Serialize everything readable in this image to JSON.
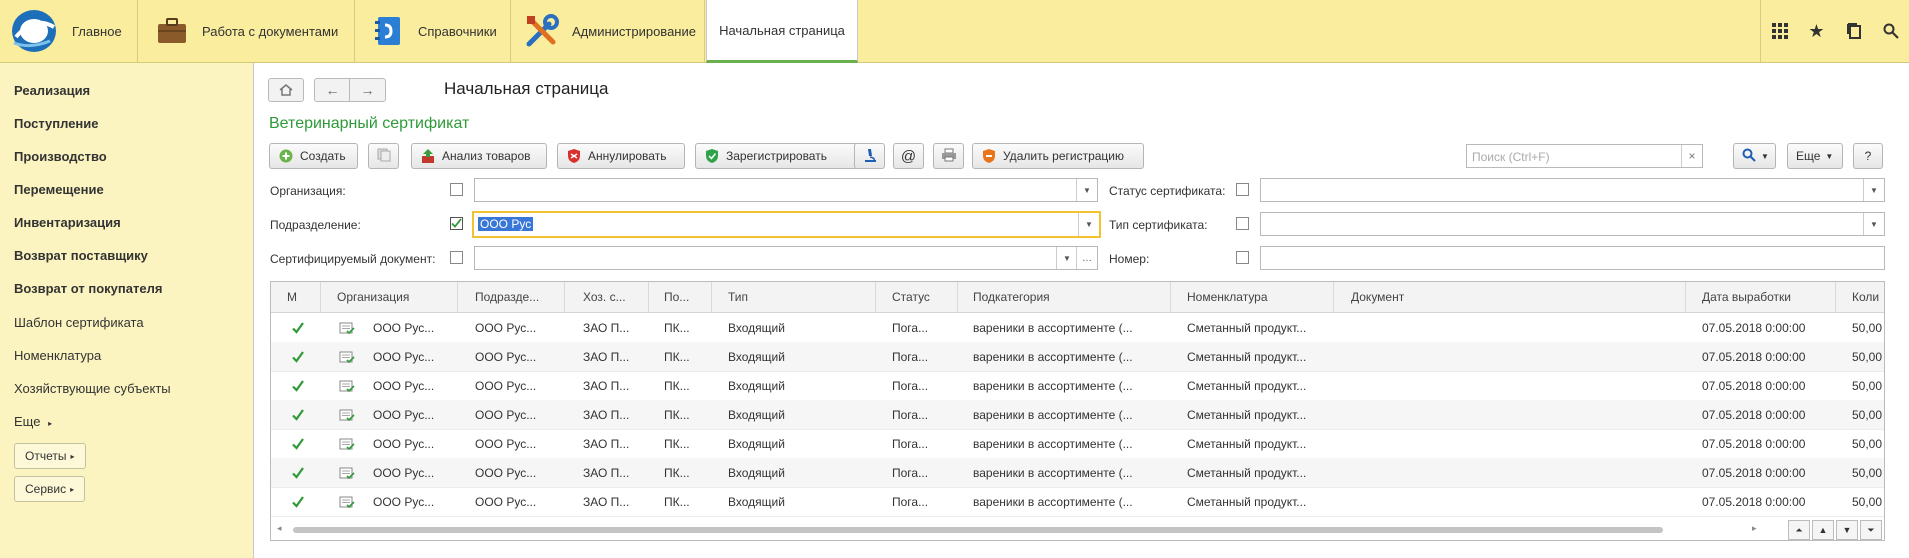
{
  "topbar": {
    "home_label": "Главное",
    "sections": [
      {
        "label": "Работа с документами",
        "icon": "briefcase-icon"
      },
      {
        "label": "Справочники",
        "icon": "phonebook-icon"
      },
      {
        "label": "Администрирование",
        "icon": "tools-icon"
      }
    ],
    "active_tab": "Начальная страница",
    "right_icons": [
      "grid-icon",
      "star-icon",
      "history-icon",
      "search-icon"
    ]
  },
  "sidebar": {
    "bold_items": [
      "Реализация",
      "Поступление",
      "Производство",
      "Перемещение",
      "Инвентаризация",
      "Возврат поставщику",
      "Возврат от покупателя"
    ],
    "items": [
      "Шаблон сертификата",
      "Номенклатура",
      "Хозяйствующие субъекты"
    ],
    "more_label": "Еще",
    "reports_label": "Отчеты",
    "service_label": "Сервис"
  },
  "page": {
    "title": "Начальная страница",
    "form_title": "Ветеринарный сертификат"
  },
  "toolbar": {
    "create": "Создать",
    "analyze": "Анализ товаров",
    "annul": "Аннулировать",
    "register": "Зарегистрировать",
    "at": "@",
    "delete_reg": "Удалить регистрацию",
    "search_placeholder": "Поиск (Ctrl+F)",
    "more": "Еще",
    "help": "?"
  },
  "filters": {
    "org_label": "Организация:",
    "dept_label": "Подразделение:",
    "dept_value": "ООО Рус",
    "doc_label": "Сертифицируемый документ:",
    "status_label": "Статус сертификата:",
    "type_label": "Тип сертификата:",
    "number_label": "Номер:"
  },
  "table": {
    "headers": [
      "М",
      "Организация",
      "Подразде...",
      "Хоз. с...",
      "По...",
      "Тип",
      "Статус",
      "Подкатегория",
      "Номенклатура",
      "Документ",
      "Дата выработки",
      "Коли"
    ],
    "rows": [
      {
        "org": "ООО Рус...",
        "dept": "ООО Рус...",
        "hoz": "ЗАО П...",
        "po": "ПК...",
        "type": "Входящий",
        "status": "Пога...",
        "subcat": "вареники в ассортименте (...",
        "nom": "Сметанный продукт...",
        "doc": "",
        "date": "07.05.2018 0:00:00",
        "qty": "50,00"
      },
      {
        "org": "ООО Рус...",
        "dept": "ООО Рус...",
        "hoz": "ЗАО П...",
        "po": "ПК...",
        "type": "Входящий",
        "status": "Пога...",
        "subcat": "вареники в ассортименте (...",
        "nom": "Сметанный продукт...",
        "doc": "",
        "date": "07.05.2018 0:00:00",
        "qty": "50,00"
      },
      {
        "org": "ООО Рус...",
        "dept": "ООО Рус...",
        "hoz": "ЗАО П...",
        "po": "ПК...",
        "type": "Входящий",
        "status": "Пога...",
        "subcat": "вареники в ассортименте (...",
        "nom": "Сметанный продукт...",
        "doc": "",
        "date": "07.05.2018 0:00:00",
        "qty": "50,00"
      },
      {
        "org": "ООО Рус...",
        "dept": "ООО Рус...",
        "hoz": "ЗАО П...",
        "po": "ПК...",
        "type": "Входящий",
        "status": "Пога...",
        "subcat": "вареники в ассортименте (...",
        "nom": "Сметанный продукт...",
        "doc": "",
        "date": "07.05.2018 0:00:00",
        "qty": "50,00"
      },
      {
        "org": "ООО Рус...",
        "dept": "ООО Рус...",
        "hoz": "ЗАО П...",
        "po": "ПК...",
        "type": "Входящий",
        "status": "Пога...",
        "subcat": "вареники в ассортименте (...",
        "nom": "Сметанный продукт...",
        "doc": "",
        "date": "07.05.2018 0:00:00",
        "qty": "50,00"
      },
      {
        "org": "ООО Рус...",
        "dept": "ООО Рус...",
        "hoz": "ЗАО П...",
        "po": "ПК...",
        "type": "Входящий",
        "status": "Пога...",
        "subcat": "вареники в ассортименте (...",
        "nom": "Сметанный продукт...",
        "doc": "",
        "date": "07.05.2018 0:00:00",
        "qty": "50,00"
      },
      {
        "org": "ООО Рус...",
        "dept": "ООО Рус...",
        "hoz": "ЗАО П...",
        "po": "ПК...",
        "type": "Входящий",
        "status": "Пога...",
        "subcat": "вареники в ассортименте (...",
        "nom": "Сметанный продукт...",
        "doc": "",
        "date": "07.05.2018 0:00:00",
        "qty": "50,00"
      }
    ]
  },
  "colors": {
    "accent_green": "#2e9a38",
    "topbar": "#fbed9e",
    "sidebar": "#fbf4c0",
    "focus": "#f2c230"
  }
}
